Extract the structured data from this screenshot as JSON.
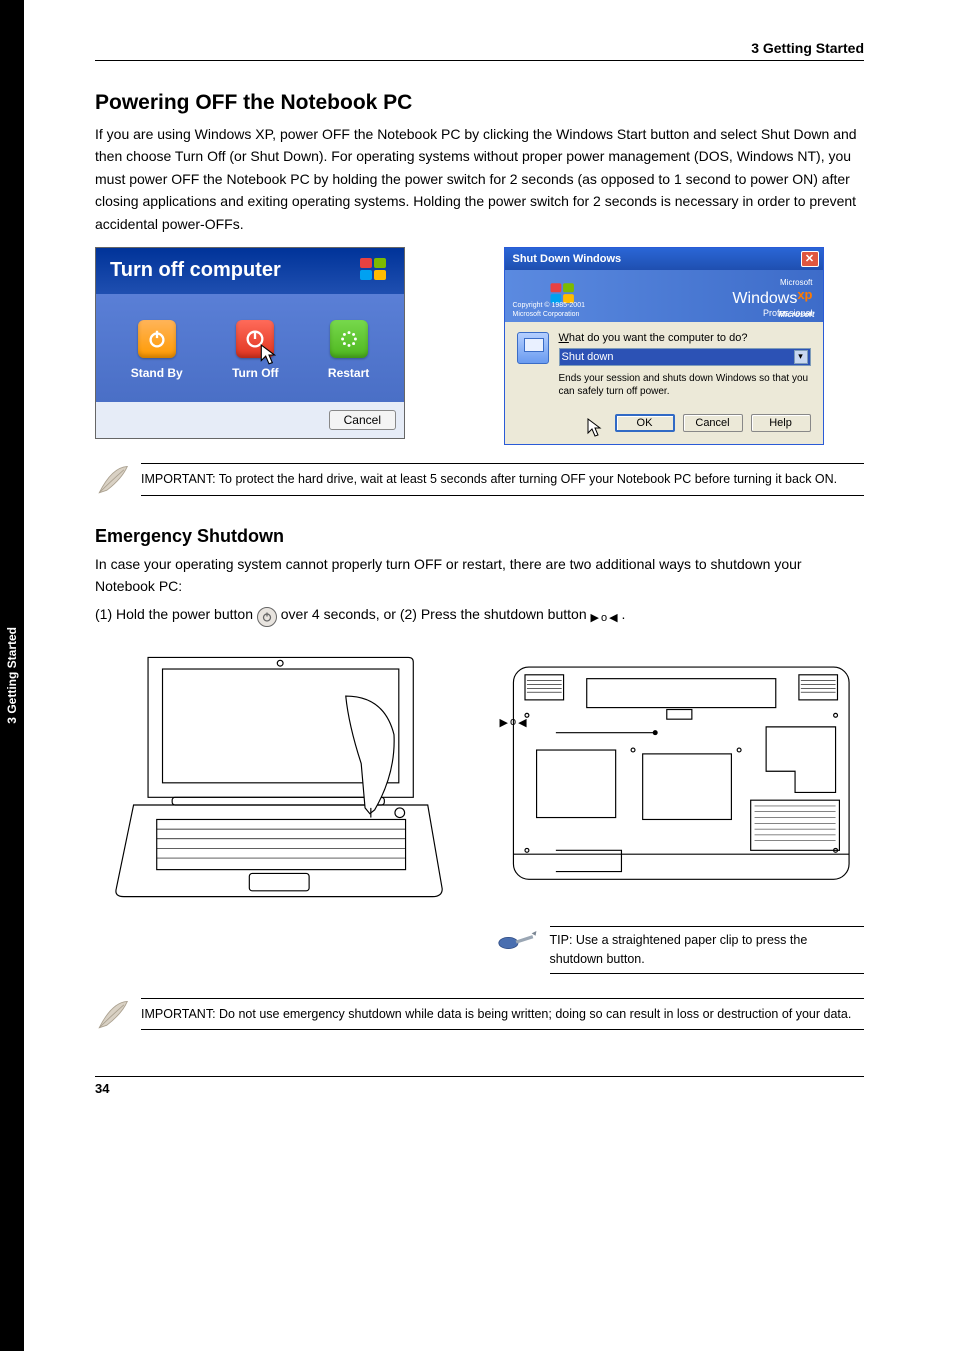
{
  "side_tab": "3    Getting Started",
  "header_right": "3    Getting Started",
  "section1_title": "Powering OFF the Notebook PC",
  "section1_p1": "If you are using Windows XP, power OFF the Notebook PC by clicking the Windows Start button and select Shut Down and then choose Turn Off (or Shut Down). For operating systems without proper power management (DOS, Windows NT), you must power OFF the Notebook PC by holding the power switch for 2 seconds (as opposed to 1 second to power ON) after closing applications and exiting operating systems. Holding the power switch for 2 seconds is necessary in order to prevent accidental power-OFFs.",
  "turnoff": {
    "title": "Turn off computer",
    "standby": "Stand By",
    "off": "Turn Off",
    "restart": "Restart",
    "cancel": "Cancel"
  },
  "shutdown": {
    "titlebar": "Shut Down Windows",
    "microsoft_small": "Microsoft",
    "windows_word": "Windows",
    "xp": "xp",
    "professional": "Professional",
    "copyright1": "Copyright © 1985-2001",
    "copyright2": "Microsoft Corporation",
    "ms_brand": "Microsoft",
    "prompt": "What do you want the computer to do?",
    "selected": "Shut down",
    "desc": "Ends your session and shuts down Windows so that you can safely turn off power.",
    "ok": "OK",
    "cancel": "Cancel",
    "help": "Help",
    "underline_w": "W"
  },
  "important_note": "IMPORTANT: To protect the hard drive, wait at least 5 seconds after turning OFF your Notebook PC before turning it back ON.",
  "emergency_title": "Emergency Shutdown",
  "emergency_text_a": "In case your operating system cannot properly turn OFF or restart, there are two additional ways to shutdown your Notebook PC:",
  "emergency_opt1_a": "(1) Hold the power button ",
  "emergency_opt1_b": " over 4 seconds, or (2) Press the shutdown button ",
  "emergency_opt1_c": ".",
  "tip_text": "TIP: Use a straightened paper clip to press the shutdown button.",
  "important2": "IMPORTANT: Do not use emergency shutdown while data is being written; doing so can result in loss or destruction of your data.",
  "footer_page": "34"
}
